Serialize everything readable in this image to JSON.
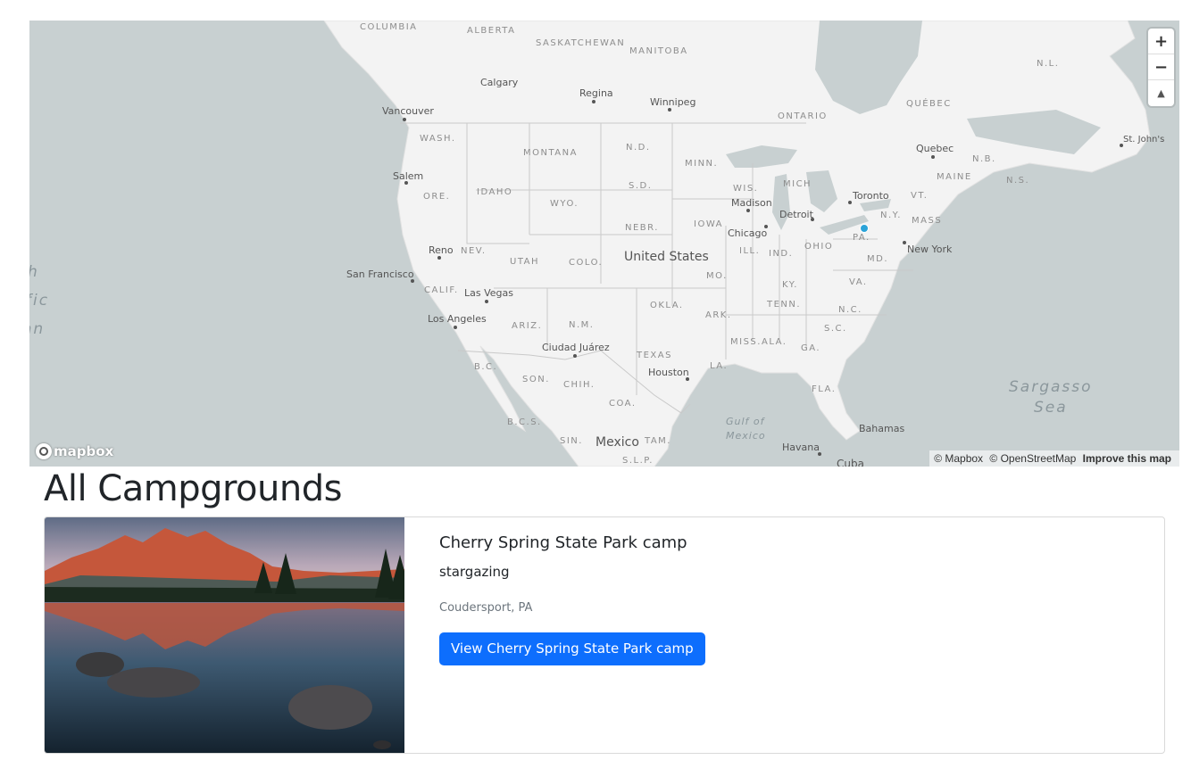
{
  "map": {
    "country_labels": [
      {
        "id": "united-states",
        "text": "United States"
      },
      {
        "id": "mexico",
        "text": "Mexico"
      },
      {
        "id": "cuba",
        "text": "Cuba"
      }
    ],
    "region_labels": [
      {
        "id": "columbia",
        "text": "COLUMBIA"
      },
      {
        "id": "alberta",
        "text": "ALBERTA"
      },
      {
        "id": "saskatchewan",
        "text": "SASKATCHEWAN"
      },
      {
        "id": "manitoba",
        "text": "MANITOBA"
      },
      {
        "id": "ontario",
        "text": "ONTARIO"
      },
      {
        "id": "quebec",
        "text": "QUÉBEC"
      },
      {
        "id": "nl",
        "text": "N.L."
      },
      {
        "id": "nb",
        "text": "N.B."
      },
      {
        "id": "ns",
        "text": "N.S."
      },
      {
        "id": "maine",
        "text": "MAINE"
      },
      {
        "id": "vt",
        "text": "VT."
      },
      {
        "id": "mass",
        "text": "MASS"
      },
      {
        "id": "ny",
        "text": "N.Y."
      },
      {
        "id": "pa",
        "text": "PA."
      },
      {
        "id": "md",
        "text": "MD."
      },
      {
        "id": "va",
        "text": "VA."
      },
      {
        "id": "nc",
        "text": "N.C."
      },
      {
        "id": "sc",
        "text": "S.C."
      },
      {
        "id": "ga",
        "text": "GA."
      },
      {
        "id": "fla",
        "text": "FLA."
      },
      {
        "id": "ala",
        "text": "ALA."
      },
      {
        "id": "miss",
        "text": "MISS."
      },
      {
        "id": "la",
        "text": "LA."
      },
      {
        "id": "tenn",
        "text": "TENN."
      },
      {
        "id": "ky",
        "text": "KY."
      },
      {
        "id": "ohio",
        "text": "OHIO"
      },
      {
        "id": "ind",
        "text": "IND."
      },
      {
        "id": "ill",
        "text": "ILL."
      },
      {
        "id": "mich",
        "text": "MICH"
      },
      {
        "id": "wis",
        "text": "WIS."
      },
      {
        "id": "minn",
        "text": "MINN."
      },
      {
        "id": "iowa",
        "text": "IOWA"
      },
      {
        "id": "mo",
        "text": "MO."
      },
      {
        "id": "ark",
        "text": "ARK."
      },
      {
        "id": "okla",
        "text": "OKLA."
      },
      {
        "id": "texas",
        "text": "TEXAS"
      },
      {
        "id": "nebr",
        "text": "NEBR."
      },
      {
        "id": "sd",
        "text": "S.D."
      },
      {
        "id": "nd",
        "text": "N.D."
      },
      {
        "id": "montana",
        "text": "MONTANA"
      },
      {
        "id": "wyo",
        "text": "WYO."
      },
      {
        "id": "colo",
        "text": "COLO."
      },
      {
        "id": "nm",
        "text": "N.M."
      },
      {
        "id": "ariz",
        "text": "ARIZ."
      },
      {
        "id": "utah",
        "text": "UTAH"
      },
      {
        "id": "nev",
        "text": "NEV."
      },
      {
        "id": "calif",
        "text": "CALIF."
      },
      {
        "id": "idaho",
        "text": "IDAHO"
      },
      {
        "id": "ore",
        "text": "ORE."
      },
      {
        "id": "wash",
        "text": "WASH."
      },
      {
        "id": "bc",
        "text": "B.C."
      },
      {
        "id": "bcs",
        "text": "B.C.S."
      },
      {
        "id": "son",
        "text": "SON."
      },
      {
        "id": "chih",
        "text": "CHIH."
      },
      {
        "id": "coa",
        "text": "COA."
      },
      {
        "id": "sin",
        "text": "SIN."
      },
      {
        "id": "tam",
        "text": "TAM."
      },
      {
        "id": "slp",
        "text": "S.L.P."
      }
    ],
    "city_labels": [
      {
        "id": "calgary",
        "text": "Calgary"
      },
      {
        "id": "regina",
        "text": "Regina"
      },
      {
        "id": "winnipeg",
        "text": "Winnipeg"
      },
      {
        "id": "vancouver",
        "text": "Vancouver"
      },
      {
        "id": "salem",
        "text": "Salem"
      },
      {
        "id": "reno",
        "text": "Reno"
      },
      {
        "id": "san-francisco",
        "text": "San Francisco"
      },
      {
        "id": "las-vegas",
        "text": "Las Vegas"
      },
      {
        "id": "los-angeles",
        "text": "Los Angeles"
      },
      {
        "id": "ciudad-juarez",
        "text": "Ciudad Juárez"
      },
      {
        "id": "houston",
        "text": "Houston"
      },
      {
        "id": "chicago",
        "text": "Chicago"
      },
      {
        "id": "madison",
        "text": "Madison"
      },
      {
        "id": "detroit",
        "text": "Detroit"
      },
      {
        "id": "toronto",
        "text": "Toronto"
      },
      {
        "id": "new-york",
        "text": "New York"
      },
      {
        "id": "quebec-city",
        "text": "Quebec"
      },
      {
        "id": "st-johns",
        "text": "St. John's"
      },
      {
        "id": "havana",
        "text": "Havana"
      },
      {
        "id": "bahamas",
        "text": "Bahamas"
      }
    ],
    "water_labels": [
      {
        "id": "pacific-1",
        "text": "h"
      },
      {
        "id": "pacific-2",
        "text": "fic"
      },
      {
        "id": "pacific-3",
        "text": "an"
      },
      {
        "id": "gulf-1",
        "text": "Gulf of"
      },
      {
        "id": "gulf-2",
        "text": "Mexico"
      },
      {
        "id": "sargasso-1",
        "text": "Sargasso"
      },
      {
        "id": "sargasso-2",
        "text": "Sea"
      }
    ],
    "controls": {
      "zoom_in": "+",
      "zoom_out": "−",
      "compass": "▲"
    },
    "logo_text": "mapbox",
    "attribution": {
      "mapbox": "© Mapbox",
      "osm": "© OpenStreetMap",
      "improve": "Improve this map"
    },
    "colors": {
      "water": "#c8d0d1",
      "land": "#f3f3f3",
      "border": "#c9c9c9",
      "marker": "#2aa3d8"
    }
  },
  "page": {
    "title": "All Campgrounds"
  },
  "campgrounds": [
    {
      "title": "Cherry Spring State Park camp",
      "description": "stargazing",
      "location": "Coudersport, PA",
      "button_label": "View Cherry Spring State Park camp"
    }
  ],
  "colors": {
    "primary_button": "#0d6efd",
    "muted_text": "#6c757d"
  }
}
